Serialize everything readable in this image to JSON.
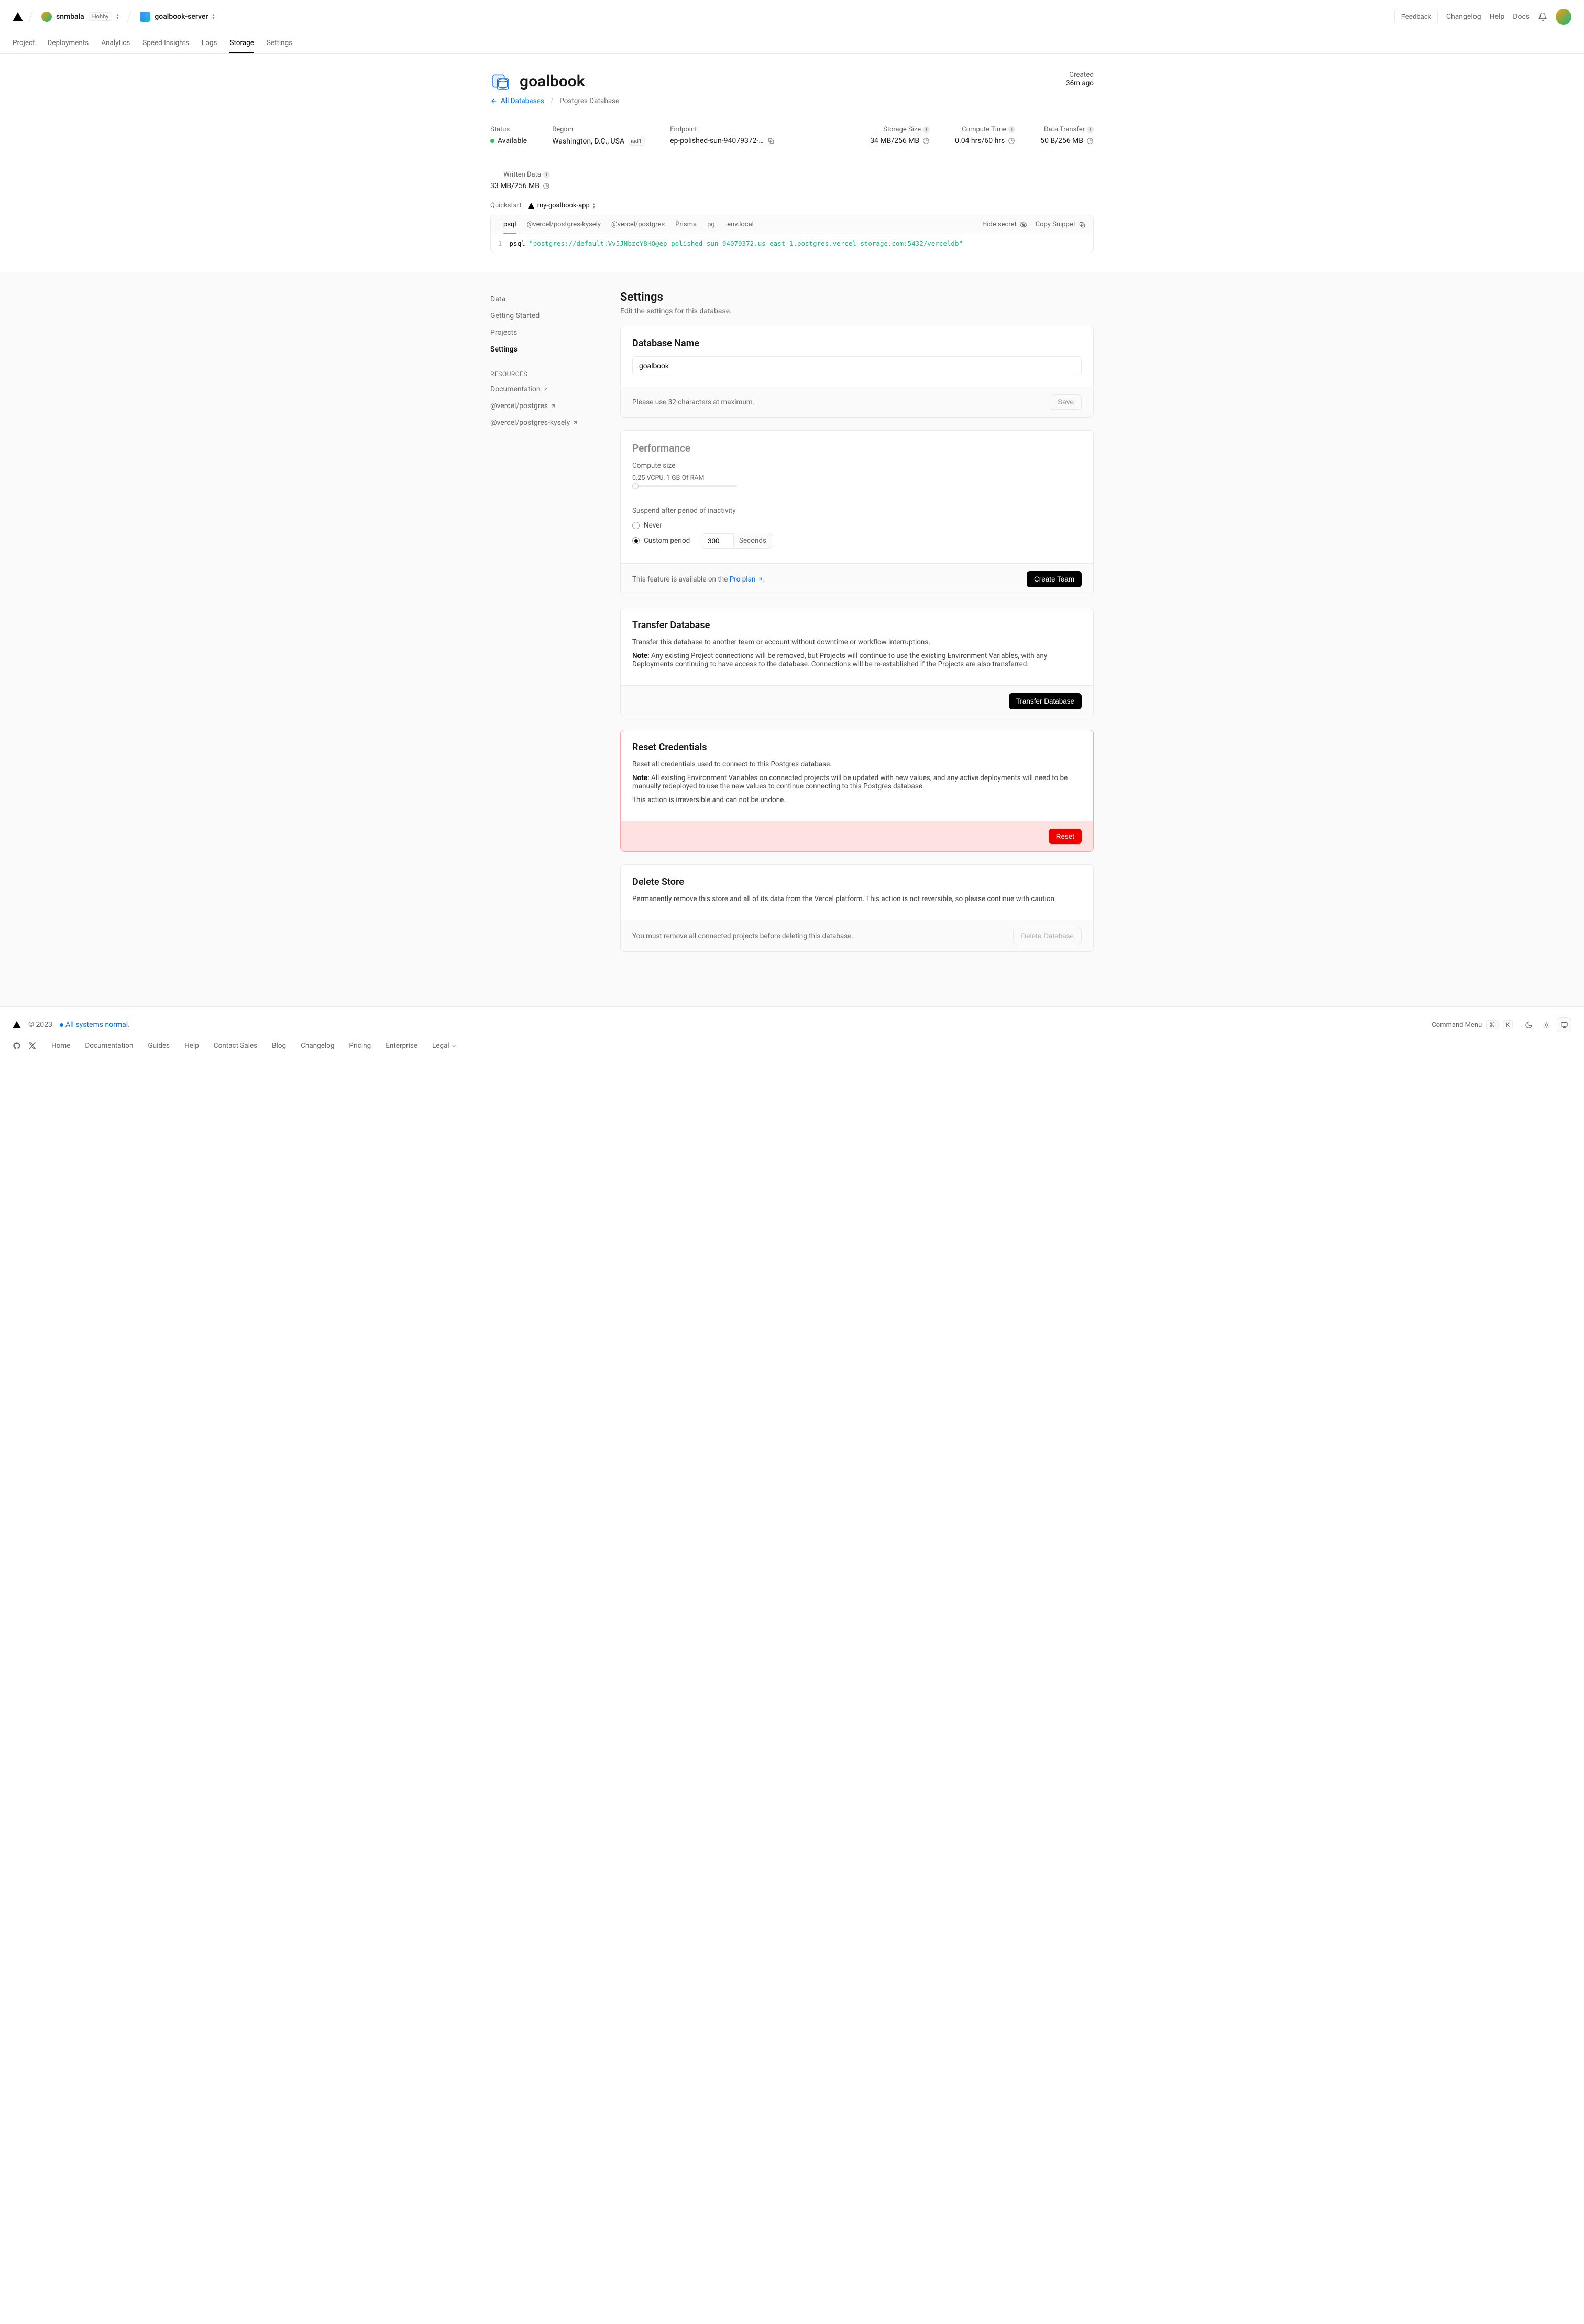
{
  "header": {
    "scope_name": "snmbala",
    "plan_badge": "Hobby",
    "project_name": "goalbook-server",
    "feedback": "Feedback",
    "changelog": "Changelog",
    "help": "Help",
    "docs": "Docs"
  },
  "tabs": [
    "Project",
    "Deployments",
    "Analytics",
    "Speed Insights",
    "Logs",
    "Storage",
    "Settings"
  ],
  "active_tab": "Storage",
  "page": {
    "title": "goalbook",
    "all_db_link": "All Databases",
    "breadcrumb_current": "Postgres Database",
    "created_label": "Created",
    "created_value": "36m ago"
  },
  "stats": {
    "status_label": "Status",
    "status_value": "Available",
    "region_label": "Region",
    "region_value": "Washington, D.C., USA",
    "region_code": "iad1",
    "endpoint_label": "Endpoint",
    "endpoint_value": "ep-polished-sun-94079372-po…",
    "storage_label": "Storage Size",
    "storage_value": "34 MB/256 MB",
    "compute_label": "Compute Time",
    "compute_value": "0.04 hrs/60 hrs",
    "transfer_label": "Data Transfer",
    "transfer_value": "50 B/256 MB",
    "written_label": "Written Data",
    "written_value": "33 MB/256 MB"
  },
  "quickstart": {
    "label": "Quickstart",
    "app": "my-goalbook-app",
    "tabs": [
      "psql",
      "@vercel/postgres-kysely",
      "@vercel/postgres",
      "Prisma",
      "pg",
      ".env.local"
    ],
    "hide_secret": "Hide secret",
    "copy_snippet": "Copy Snippet",
    "code_prefix": "psql ",
    "code_str": "\"postgres://default:Vv5JNbzcY8HQ@ep-polished-sun-94079372.us-east-1.postgres.vercel-storage.com:5432/verceldb\""
  },
  "sidebar": {
    "items": [
      "Data",
      "Getting Started",
      "Projects",
      "Settings"
    ],
    "resources_head": "RESOURCES",
    "resources": [
      "Documentation",
      "@vercel/postgres",
      "@vercel/postgres-kysely"
    ]
  },
  "settings": {
    "title": "Settings",
    "subtitle": "Edit the settings for this database.",
    "dbname_title": "Database Name",
    "dbname_value": "goalbook",
    "dbname_hint": "Please use 32 characters at maximum.",
    "save": "Save",
    "perf_title": "Performance",
    "compute_size": "Compute size",
    "compute_label": "0.25 VCPU, 1 GB Of RAM",
    "suspend_label": "Suspend after period of inactivity",
    "never": "Never",
    "custom": "Custom period",
    "custom_value": "300",
    "seconds": "Seconds",
    "pro_text_prefix": "This feature is available on the ",
    "pro_link": "Pro plan",
    "create_team": "Create Team",
    "transfer_title": "Transfer Database",
    "transfer_desc": "Transfer this database to another team or account without downtime or workflow interruptions.",
    "transfer_note": "Any existing Project connections will be removed, but Projects will continue to use the existing Environment Variables, with any Deployments continuing to have access to the database. Connections will be re-established if the Projects are also transferred.",
    "transfer_btn": "Transfer Database",
    "reset_title": "Reset Credentials",
    "reset_desc": "Reset all credentials used to connect to this Postgres database.",
    "reset_note": "All existing Environment Variables on connected projects will be updated with new values, and any active deployments will need to be manually redeployed to use the new values to continue connecting to this Postgres database.",
    "reset_warn": "This action is irreversible and can not be undone.",
    "reset_btn": "Reset",
    "delete_title": "Delete Store",
    "delete_desc": "Permanently remove this store and all of its data from the Vercel platform. This action is not reversible, so please continue with caution.",
    "delete_hint": "You must remove all connected projects before deleting this database.",
    "delete_btn": "Delete Database",
    "note_prefix": "Note: "
  },
  "footer": {
    "copyright": "© 2023",
    "status": "All systems normal.",
    "cmd": "Command Menu",
    "links": [
      "Home",
      "Documentation",
      "Guides",
      "Help",
      "Contact Sales",
      "Blog",
      "Changelog",
      "Pricing",
      "Enterprise",
      "Legal"
    ]
  }
}
